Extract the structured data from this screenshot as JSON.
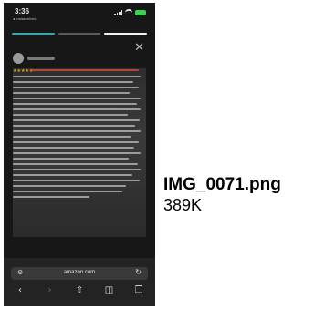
{
  "file": {
    "name": "IMG_0071.png",
    "size": "389K"
  },
  "thumbnail": {
    "status_time": "3:36",
    "status_sub": "◂ Instashelves",
    "close_glyph": "✕",
    "stars": "★★★★★",
    "url_aa": "⚙",
    "url_domain": "amazon.com",
    "url_reload": "↻",
    "toolbar": {
      "back": "‹",
      "forward": "›",
      "share": "⇧",
      "bookmarks": "◫",
      "tabs": "❐"
    }
  }
}
